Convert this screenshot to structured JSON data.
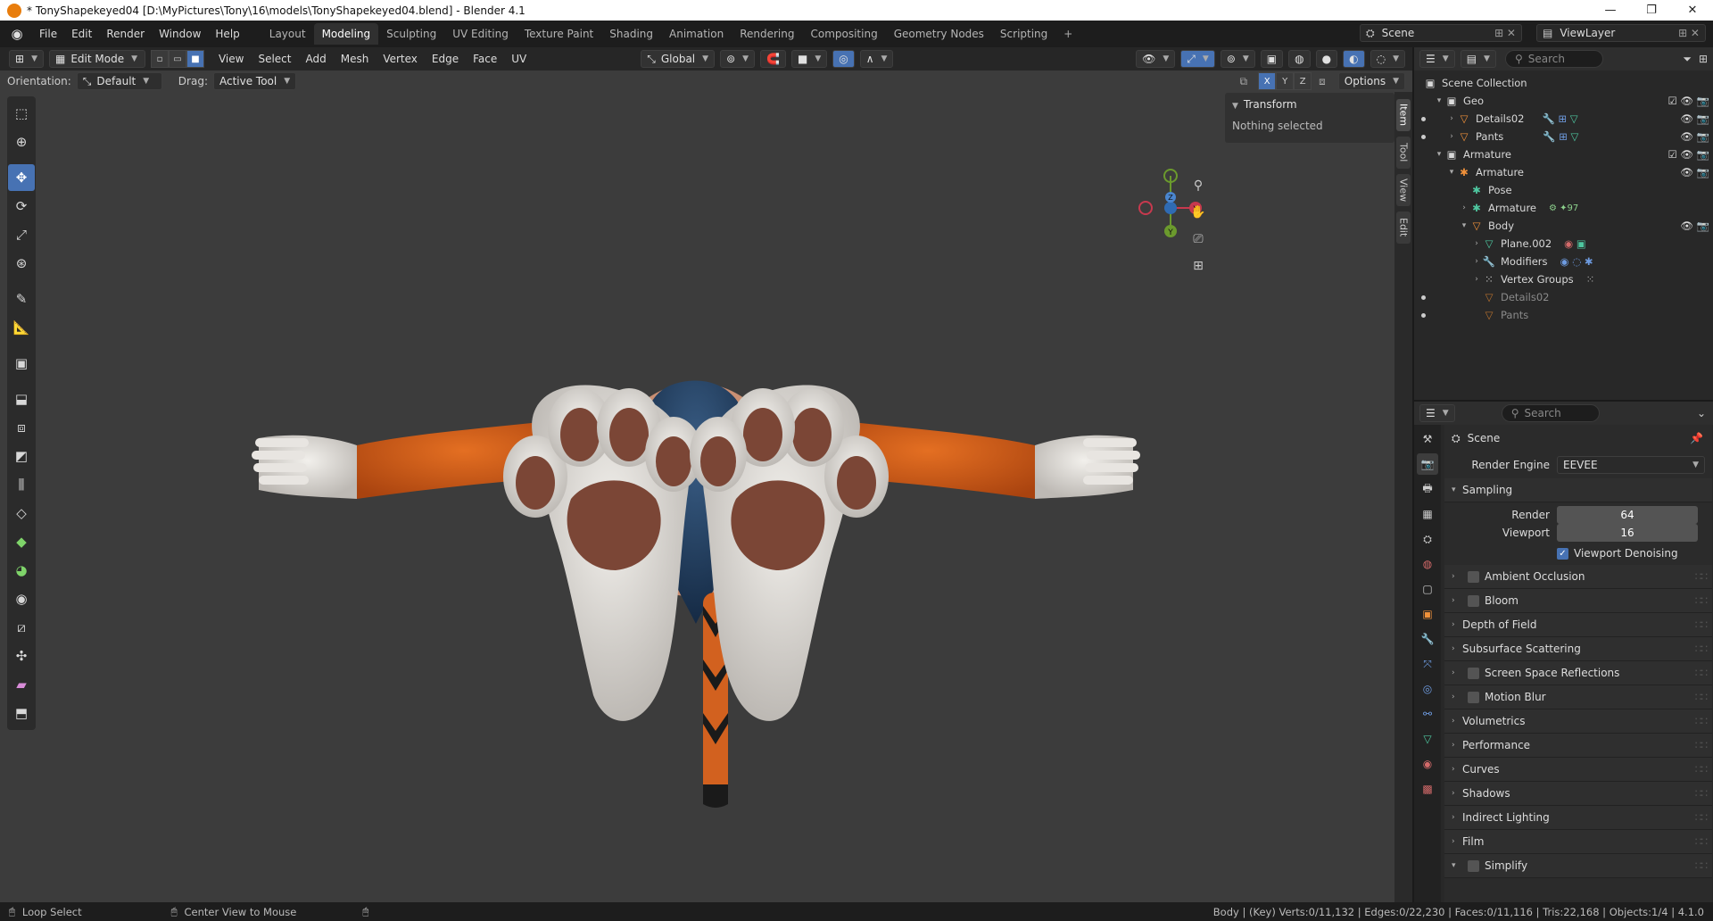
{
  "window": {
    "title": "* TonyShapekeyed04 [D:\\MyPictures\\Tony\\16\\models\\TonyShapekeyed04.blend] - Blender 4.1",
    "min": "—",
    "max": "❐",
    "close": "✕"
  },
  "menu": [
    "File",
    "Edit",
    "Render",
    "Window",
    "Help"
  ],
  "workspaces": [
    "Layout",
    "Modeling",
    "Sculpting",
    "UV Editing",
    "Texture Paint",
    "Shading",
    "Animation",
    "Rendering",
    "Compositing",
    "Geometry Nodes",
    "Scripting",
    "+"
  ],
  "active_workspace": "Modeling",
  "scene_name": "Scene",
  "view_layer": "ViewLayer",
  "header": {
    "mode": "Edit Mode",
    "menus": [
      "View",
      "Select",
      "Add",
      "Mesh",
      "Vertex",
      "Edge",
      "Face",
      "UV"
    ],
    "transform_orientation": "Global",
    "orientation_label": "Orientation:",
    "orientation_value": "Default",
    "drag_label": "Drag:",
    "drag_value": "Active Tool",
    "axes": [
      "X",
      "Y",
      "Z"
    ],
    "options": "Options"
  },
  "gizmo": {
    "x": "X",
    "y": "Y",
    "z": "Z"
  },
  "npanel": {
    "title": "Transform",
    "body": "Nothing selected",
    "tabs": [
      "Item",
      "Tool",
      "View",
      "Edit"
    ]
  },
  "outliner": {
    "search_placeholder": "Search",
    "rows": [
      {
        "label": "Scene Collection"
      },
      {
        "label": "Geo"
      },
      {
        "label": "Details02"
      },
      {
        "label": "Pants"
      },
      {
        "label": "Armature"
      },
      {
        "label": "Armature"
      },
      {
        "label": "Pose"
      },
      {
        "label": "Armature",
        "badge": "97"
      },
      {
        "label": "Body"
      },
      {
        "label": "Plane.002"
      },
      {
        "label": "Modifiers"
      },
      {
        "label": "Vertex Groups"
      },
      {
        "label": "Details02"
      },
      {
        "label": "Pants"
      }
    ]
  },
  "properties": {
    "search_placeholder": "Search",
    "title": "Scene",
    "render_engine_label": "Render Engine",
    "render_engine": "EEVEE",
    "sampling": "Sampling",
    "render_label": "Render",
    "render_value": "64",
    "viewport_label": "Viewport",
    "viewport_value": "16",
    "viewport_denoising": "Viewport Denoising",
    "sections": [
      "Ambient Occlusion",
      "Bloom",
      "Depth of Field",
      "Subsurface Scattering",
      "Screen Space Reflections",
      "Motion Blur",
      "Volumetrics",
      "Performance",
      "Curves",
      "Shadows",
      "Indirect Lighting",
      "Film",
      "Simplify"
    ]
  },
  "status": {
    "left1": "Loop Select",
    "left2": "Center View to Mouse",
    "right": "Body | (Key) Verts:0/11,132 | Edges:0/22,230 | Faces:0/11,116 | Tris:22,168 | Objects:1/4 | 4.1.0"
  },
  "colors": {
    "accent": "#4772b3",
    "skin_orange": "#d8651c",
    "fur_white": "#e6e3df",
    "paw_pad": "#7b4636",
    "pants_blue": "#1f3a5c"
  }
}
